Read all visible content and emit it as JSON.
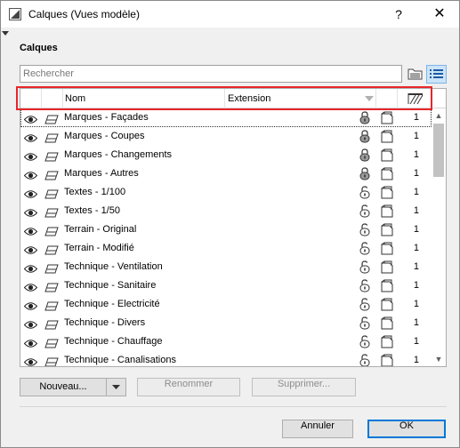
{
  "window": {
    "title": "Calques (Vues modèle)"
  },
  "titlebar": {
    "help_label": "?",
    "close_label": "✕"
  },
  "section_title": "Calques",
  "search": {
    "placeholder": "Rechercher",
    "value": ""
  },
  "table": {
    "columns": {
      "name": "Nom",
      "extension": "Extension"
    },
    "rows": [
      {
        "name": "Marques - Façades",
        "lock": "locked",
        "value": "1"
      },
      {
        "name": "Marques - Coupes",
        "lock": "locked",
        "value": "1"
      },
      {
        "name": "Marques - Changements",
        "lock": "locked",
        "value": "1"
      },
      {
        "name": "Marques - Autres",
        "lock": "locked",
        "value": "1"
      },
      {
        "name": "Textes - 1/100",
        "lock": "unlocked",
        "value": "1"
      },
      {
        "name": "Textes - 1/50",
        "lock": "unlocked",
        "value": "1"
      },
      {
        "name": "Terrain - Original",
        "lock": "unlocked",
        "value": "1"
      },
      {
        "name": "Terrain - Modifié",
        "lock": "unlocked",
        "value": "1"
      },
      {
        "name": "Technique - Ventilation",
        "lock": "unlocked",
        "value": "1"
      },
      {
        "name": "Technique - Sanitaire",
        "lock": "unlocked",
        "value": "1"
      },
      {
        "name": "Technique - Electricité",
        "lock": "unlocked",
        "value": "1"
      },
      {
        "name": "Technique - Divers",
        "lock": "unlocked",
        "value": "1"
      },
      {
        "name": "Technique - Chauffage",
        "lock": "unlocked",
        "value": "1"
      },
      {
        "name": "Technique - Canalisations",
        "lock": "unlocked",
        "value": "1"
      }
    ]
  },
  "buttons": {
    "new_label": "Nouveau...",
    "rename_label": "Renommer",
    "delete_label": "Supprimer...",
    "cancel_label": "Annuler",
    "ok_label": "OK"
  },
  "colors": {
    "highlight_border": "#e8262a",
    "selected_view_button": "#cce4f7",
    "dialog_background": "#f0f0f0"
  },
  "icons": {
    "row": [
      "eye-icon",
      "layer-icon",
      "lock-icon",
      "wireframe-icon"
    ],
    "toolbar": [
      "folder-icon",
      "list-view-icon"
    ]
  }
}
